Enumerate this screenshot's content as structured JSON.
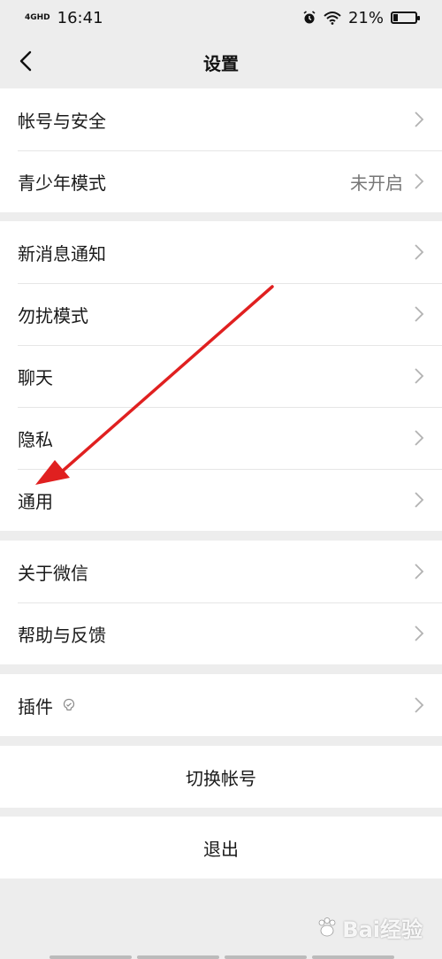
{
  "status_bar": {
    "network": "4GHD",
    "time": "16:41",
    "battery_text": "21%",
    "battery_level": 0.21,
    "icons": [
      "alarm-icon",
      "wifi-icon",
      "battery-icon"
    ]
  },
  "header": {
    "title": "设置",
    "back_icon": "chevron-left-icon"
  },
  "groups": [
    {
      "items": [
        {
          "label": "帐号与安全"
        },
        {
          "label": "青少年模式",
          "value": "未开启"
        }
      ]
    },
    {
      "items": [
        {
          "label": "新消息通知"
        },
        {
          "label": "勿扰模式"
        },
        {
          "label": "聊天"
        },
        {
          "label": "隐私"
        },
        {
          "label": "通用"
        }
      ]
    },
    {
      "items": [
        {
          "label": "关于微信"
        },
        {
          "label": "帮助与反馈"
        }
      ]
    },
    {
      "items": [
        {
          "label": "插件",
          "icon": "plugin-icon"
        }
      ]
    }
  ],
  "actions": {
    "switch_account": "切换帐号",
    "logout": "退出"
  },
  "watermark": {
    "text": "Bai经验",
    "icon": "paw-icon"
  },
  "colors": {
    "background": "#ededed",
    "card": "#ffffff",
    "annotation_arrow": "#e02020",
    "chevron": "#b2b2b2"
  }
}
